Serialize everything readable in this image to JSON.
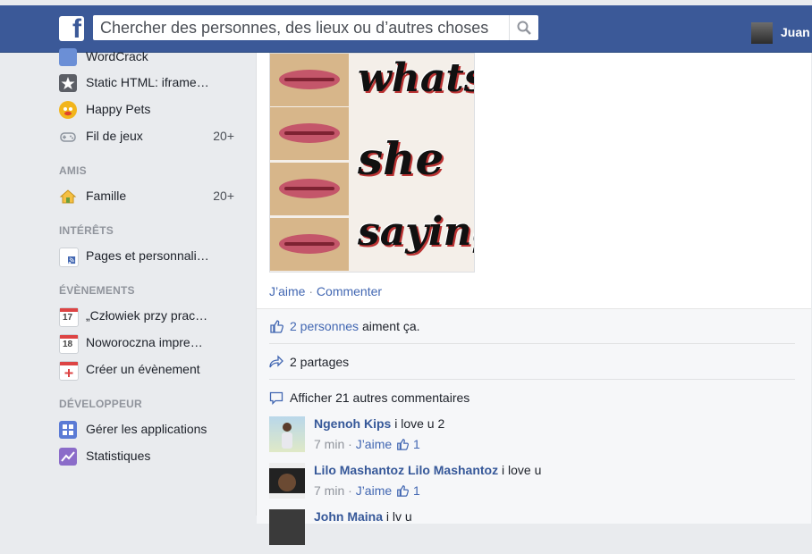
{
  "topbar": {
    "logo": "f",
    "search_placeholder": "Chercher des personnes, des lieux ou d’autres choses",
    "user_name": "Juan"
  },
  "sidebar": {
    "apps": [
      {
        "label": "WordCrack",
        "icon": "wordcrack-icon"
      },
      {
        "label": "Static HTML: iframe…",
        "icon": "star-icon"
      },
      {
        "label": "Happy Pets",
        "icon": "happy-pets-icon"
      },
      {
        "label": "Fil de jeux",
        "icon": "gamepad-icon",
        "count": "20+"
      }
    ],
    "amis_header": "AMIS",
    "amis": [
      {
        "label": "Famille",
        "icon": "house-icon",
        "count": "20+"
      }
    ],
    "interets_header": "INTÉRÊTS",
    "interets": [
      {
        "label": "Pages et personnali…",
        "icon": "rss-icon"
      }
    ],
    "evenements_header": "ÉVÈNEMENTS",
    "evenements": [
      {
        "label": "„Człowiek przy prac…",
        "icon": "calendar-icon",
        "day": "17"
      },
      {
        "label": "Noworoczna impre…",
        "icon": "calendar-icon",
        "day": "18"
      },
      {
        "label": "Créer un évènement",
        "icon": "add-calendar-icon"
      }
    ],
    "dev_header": "DÉVELOPPEUR",
    "dev": [
      {
        "label": "Gérer les applications",
        "icon": "apps-icon"
      },
      {
        "label": "Statistiques",
        "icon": "chart-icon"
      }
    ]
  },
  "post": {
    "image_words": [
      "whats",
      "she",
      "saying"
    ],
    "like_label": "J’aime",
    "separator": "·",
    "comment_label": "Commenter",
    "likes_link": "2 personnes",
    "likes_text": " aiment ça.",
    "shares": "2 partages",
    "more_comments": "Afficher 21 autres commentaires"
  },
  "comments": [
    {
      "author": "Ngenoh Kips",
      "text": " i love u 2",
      "time": "7 min",
      "like": "J’aime",
      "likes": "1"
    },
    {
      "author": "Lilo Mashantoz Lilo Mashantoz",
      "text": " i love u",
      "time": "7 min",
      "like": "J’aime",
      "likes": "1"
    },
    {
      "author": "John Maina",
      "text": " i lv u"
    }
  ],
  "colors": {
    "bluebar": "#3b5998",
    "link": "#4267b2",
    "author": "#365899"
  }
}
